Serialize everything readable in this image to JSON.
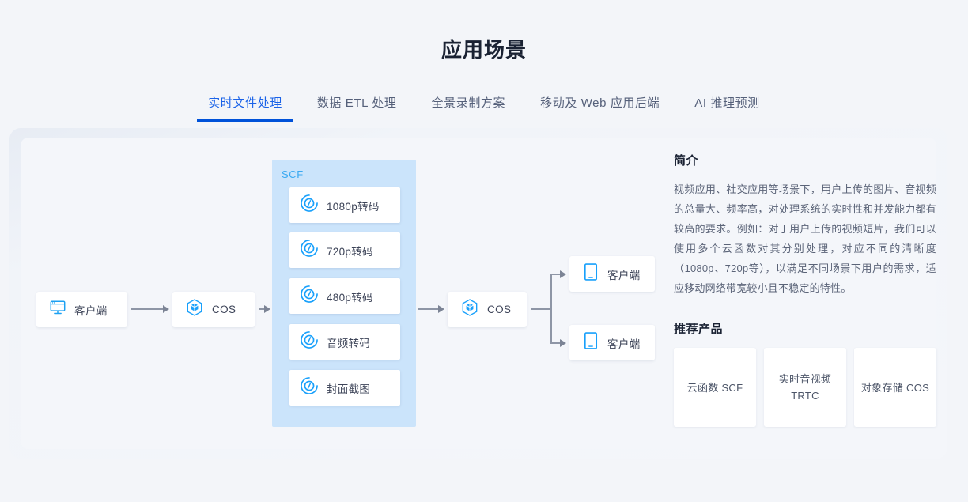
{
  "header": {
    "title": "应用场景",
    "tabs": [
      {
        "label": "实时文件处理",
        "active": true
      },
      {
        "label": "数据 ETL 处理",
        "active": false
      },
      {
        "label": "全景录制方案",
        "active": false
      },
      {
        "label": "移动及 Web 应用后端",
        "active": false
      },
      {
        "label": "AI 推理预测",
        "active": false
      }
    ],
    "active_color": "#1a62e8",
    "underline_color": "#0052d9"
  },
  "diagram": {
    "client_left": {
      "label": "客户端",
      "icon": "monitor-icon"
    },
    "cos_1": {
      "label": "COS",
      "icon": "cos-hexagon-icon"
    },
    "cos_2": {
      "label": "COS",
      "icon": "cos-hexagon-icon"
    },
    "scf_group": {
      "title": "SCF",
      "background": "#cbe4fb",
      "title_color": "#39a9f2",
      "items": [
        {
          "label": "1080p转码",
          "icon": "scf-icon"
        },
        {
          "label": "720p转码",
          "icon": "scf-icon"
        },
        {
          "label": "480p转码",
          "icon": "scf-icon"
        },
        {
          "label": "音频转码",
          "icon": "scf-icon"
        },
        {
          "label": "封面截图",
          "icon": "scf-icon"
        }
      ]
    },
    "clients_right": [
      {
        "label": "客户端",
        "icon": "mobile-icon"
      },
      {
        "label": "客户端",
        "icon": "mobile-icon"
      }
    ]
  },
  "info": {
    "intro_heading": "简介",
    "intro_text": "视频应用、社交应用等场景下，用户上传的图片、音视频的总量大、频率高，对处理系统的实时性和并发能力都有较高的要求。例如：对于用户上传的视频短片，我们可以使用多个云函数对其分别处理，对应不同的清晰度（1080p、720p等），以满足不同场景下用户的需求，适应移动网络带宽较小且不稳定的特性。",
    "products_heading": "推荐产品",
    "products": [
      {
        "name": "云函数 SCF"
      },
      {
        "name": "实时音视频 TRTC"
      },
      {
        "name": "对象存储 COS"
      }
    ]
  }
}
